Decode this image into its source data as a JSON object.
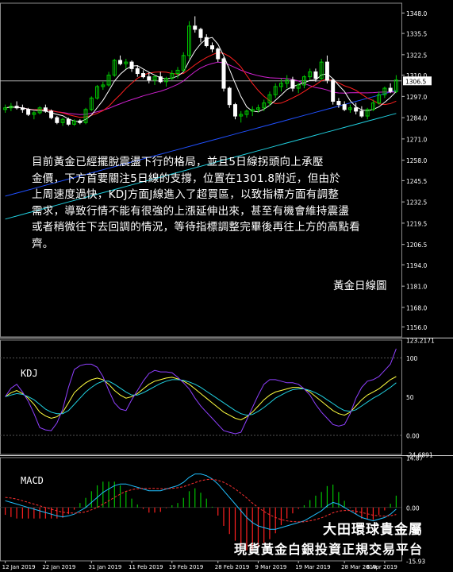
{
  "commentary": {
    "lines": [
      "目前黃金已經擺脫震盪下行的格局，並且5日線拐頭向上承壓",
      "金價，下方首要關注5日線的支撐，位置在1301.8附近，但由於",
      "上周速度過快，KDJ方面J線進入了超買區，以致指標方面有調整",
      "需求，導致行情不能有很強的上漲延伸出來，甚至有機會維持震盪",
      "或者稍微往下去回調的情況，等待指標調整完畢後再往上方的高點看",
      "齊。"
    ]
  },
  "chart_title": "黃金日線圖",
  "brand": {
    "line1": "大田環球貴金屬",
    "line2": "現貨黃金白銀投資正規交易平台"
  },
  "colors": {
    "bull_candle": "#00c800",
    "bear_candle": "#ffffff",
    "ma5": "#ffffff",
    "ma10": "#ff2020",
    "ma20": "#d020d0",
    "ma60": "#2050ff",
    "ma120": "#20d0e0",
    "k_line": "#ffff40",
    "d_line": "#20d0e0",
    "j_line": "#9040ff",
    "macd_line": "#20c0ff",
    "signal_line": "#ff3030",
    "hist_pos": "#00c000",
    "hist_neg": "#ff2020",
    "current_price_line": "#c0c0c0",
    "price_tag_bg": "#ffffff"
  },
  "chart_data": [
    {
      "type": "candlestick",
      "panel": "price",
      "current_price": 1306.5,
      "ylim": [
        1150,
        1354
      ],
      "y_ticks": [
        1348.0,
        1335.5,
        1322.5,
        1310.0,
        1297.0,
        1284.0,
        1271.0,
        1258.0,
        1245.5,
        1232.5,
        1219.5,
        1206.5,
        1194.0,
        1181.0,
        1168.0,
        1156.0
      ],
      "x_tick_labels": [
        "12 Jan 2019",
        "22 Jan 2019",
        "31 Jan 2019",
        "11 Feb 2019",
        "19 Feb 2019",
        "28 Feb 2019",
        "9 Mar 2019",
        "19 Mar 2019",
        "28 Mar 2019",
        "6 Apr 2019"
      ],
      "ohlc": [
        [
          1289,
          1292,
          1287,
          1290
        ],
        [
          1290,
          1293,
          1288,
          1291
        ],
        [
          1291,
          1294,
          1289,
          1290
        ],
        [
          1290,
          1292,
          1287,
          1289
        ],
        [
          1289,
          1290,
          1285,
          1286
        ],
        [
          1286,
          1288,
          1283,
          1287
        ],
        [
          1287,
          1291,
          1286,
          1290
        ],
        [
          1290,
          1292,
          1287,
          1288
        ],
        [
          1288,
          1289,
          1283,
          1284
        ],
        [
          1284,
          1285,
          1280,
          1281
        ],
        [
          1281,
          1284,
          1279,
          1283
        ],
        [
          1283,
          1284,
          1279,
          1280
        ],
        [
          1280,
          1283,
          1279,
          1282
        ],
        [
          1282,
          1283,
          1280,
          1281
        ],
        [
          1281,
          1290,
          1280,
          1289
        ],
        [
          1289,
          1297,
          1288,
          1296
        ],
        [
          1296,
          1304,
          1295,
          1303
        ],
        [
          1303,
          1306,
          1301,
          1304
        ],
        [
          1304,
          1312,
          1303,
          1310
        ],
        [
          1310,
          1320,
          1309,
          1319
        ],
        [
          1319,
          1322,
          1316,
          1317
        ],
        [
          1317,
          1320,
          1314,
          1318
        ],
        [
          1318,
          1319,
          1312,
          1314
        ],
        [
          1314,
          1316,
          1309,
          1311
        ],
        [
          1311,
          1313,
          1308,
          1309
        ],
        [
          1309,
          1312,
          1305,
          1307
        ],
        [
          1307,
          1310,
          1304,
          1309
        ],
        [
          1309,
          1312,
          1305,
          1306
        ],
        [
          1306,
          1309,
          1303,
          1308
        ],
        [
          1308,
          1313,
          1307,
          1311
        ],
        [
          1311,
          1315,
          1308,
          1313
        ],
        [
          1313,
          1324,
          1312,
          1322
        ],
        [
          1322,
          1343,
          1320,
          1340
        ],
        [
          1340,
          1346,
          1336,
          1338
        ],
        [
          1338,
          1339,
          1330,
          1333
        ],
        [
          1333,
          1335,
          1327,
          1328
        ],
        [
          1328,
          1330,
          1324,
          1326
        ],
        [
          1326,
          1327,
          1318,
          1320
        ],
        [
          1320,
          1321,
          1300,
          1302
        ],
        [
          1302,
          1303,
          1290,
          1292
        ],
        [
          1292,
          1293,
          1283,
          1285
        ],
        [
          1285,
          1288,
          1281,
          1286
        ],
        [
          1286,
          1289,
          1284,
          1288
        ],
        [
          1288,
          1291,
          1285,
          1289
        ],
        [
          1289,
          1292,
          1287,
          1290
        ],
        [
          1290,
          1295,
          1288,
          1293
        ],
        [
          1293,
          1300,
          1291,
          1298
        ],
        [
          1298,
          1305,
          1296,
          1303
        ],
        [
          1303,
          1308,
          1300,
          1305
        ],
        [
          1305,
          1310,
          1302,
          1307
        ],
        [
          1307,
          1309,
          1300,
          1302
        ],
        [
          1302,
          1305,
          1299,
          1304
        ],
        [
          1304,
          1310,
          1302,
          1309
        ],
        [
          1309,
          1314,
          1307,
          1312
        ],
        [
          1312,
          1314,
          1306,
          1308
        ],
        [
          1308,
          1320,
          1307,
          1318
        ],
        [
          1318,
          1322,
          1305,
          1307
        ],
        [
          1307,
          1308,
          1292,
          1294
        ],
        [
          1294,
          1296,
          1290,
          1292
        ],
        [
          1292,
          1294,
          1288,
          1289
        ],
        [
          1289,
          1292,
          1287,
          1290
        ],
        [
          1290,
          1293,
          1286,
          1288
        ],
        [
          1288,
          1291,
          1284,
          1285
        ],
        [
          1285,
          1290,
          1283,
          1289
        ],
        [
          1289,
          1295,
          1288,
          1293
        ],
        [
          1293,
          1300,
          1292,
          1298
        ],
        [
          1298,
          1303,
          1296,
          1302
        ],
        [
          1302,
          1305,
          1299,
          1300
        ],
        [
          1300,
          1310,
          1299,
          1307
        ]
      ]
    },
    {
      "type": "line",
      "panel": "kdj",
      "title": "KDJ",
      "ylim": [
        -24.6891,
        123.2171
      ],
      "y_ticks": [
        123.2171,
        100,
        50,
        0.0,
        -24.6891
      ],
      "series": [
        {
          "name": "K",
          "values": [
            50,
            55,
            58,
            54,
            48,
            40,
            30,
            25,
            22,
            24,
            30,
            42,
            55,
            62,
            68,
            72,
            74,
            72,
            66,
            58,
            52,
            48,
            50,
            54,
            60,
            66,
            70,
            72,
            74,
            75,
            73,
            70,
            66,
            60,
            54,
            48,
            42,
            36,
            30,
            26,
            22,
            20,
            24,
            30,
            38,
            46,
            52,
            56,
            58,
            60,
            62,
            62,
            60,
            56,
            50,
            44,
            38,
            32,
            28,
            26,
            30,
            38,
            46,
            52,
            56,
            60,
            66,
            72,
            76
          ]
        },
        {
          "name": "D",
          "values": [
            50,
            52,
            54,
            53,
            50,
            46,
            40,
            34,
            30,
            28,
            28,
            32,
            40,
            48,
            56,
            62,
            67,
            70,
            70,
            66,
            61,
            56,
            52,
            52,
            55,
            59,
            63,
            67,
            70,
            72,
            72,
            71,
            69,
            66,
            62,
            57,
            52,
            47,
            42,
            37,
            32,
            28,
            26,
            27,
            31,
            36,
            42,
            48,
            52,
            56,
            59,
            60,
            60,
            58,
            55,
            51,
            46,
            41,
            36,
            32,
            31,
            33,
            38,
            43,
            48,
            52,
            57,
            62,
            68
          ]
        },
        {
          "name": "J",
          "values": [
            50,
            61,
            66,
            56,
            44,
            28,
            10,
            7,
            6,
            16,
            34,
            62,
            85,
            90,
            92,
            92,
            88,
            76,
            58,
            42,
            34,
            32,
            46,
            58,
            70,
            80,
            84,
            82,
            82,
            81,
            75,
            68,
            60,
            48,
            38,
            30,
            22,
            14,
            6,
            4,
            2,
            4,
            20,
            36,
            52,
            66,
            72,
            72,
            70,
            68,
            68,
            66,
            60,
            52,
            40,
            30,
            22,
            14,
            12,
            14,
            28,
            48,
            62,
            70,
            72,
            76,
            84,
            92,
            112
          ]
        }
      ]
    },
    {
      "type": "bar+line",
      "panel": "macd",
      "title": "MACD",
      "ylim": [
        -15.93,
        14.87
      ],
      "y_ticks": [
        14.87,
        0.0,
        -15.93
      ],
      "series": [
        {
          "name": "MACD",
          "values": [
            2,
            1.5,
            1,
            0.5,
            0,
            -0.5,
            -1,
            -1.5,
            -2,
            -2.5,
            -2.8,
            -2.5,
            -2,
            -1,
            0,
            1.5,
            3,
            4.5,
            5.5,
            6.5,
            7,
            7,
            6.5,
            6,
            5.5,
            5,
            5,
            5,
            5.5,
            6,
            6.5,
            7.5,
            9,
            10,
            10,
            9.5,
            8.5,
            7,
            5,
            3,
            1,
            -1,
            -3,
            -4.5,
            -5.5,
            -6,
            -6.5,
            -6.5,
            -6,
            -5.5,
            -5,
            -4.5,
            -4,
            -3,
            -2,
            -1,
            0.5,
            1.5,
            1,
            0,
            -1,
            -2,
            -3,
            -3.5,
            -4,
            -3.5,
            -3,
            -2,
            -0.5
          ]
        },
        {
          "name": "Signal",
          "values": [
            3,
            2.8,
            2.5,
            2,
            1.5,
            1,
            0.5,
            0,
            -0.5,
            -1,
            -1.4,
            -1.6,
            -1.7,
            -1.6,
            -1.3,
            -0.7,
            0,
            1,
            2,
            3,
            4,
            4.8,
            5.3,
            5.6,
            5.7,
            5.7,
            5.7,
            5.6,
            5.6,
            5.7,
            5.9,
            6.2,
            6.8,
            7.4,
            8,
            8.3,
            8.4,
            8.1,
            7.5,
            6.6,
            5.5,
            4.2,
            2.8,
            1.3,
            0,
            -1.2,
            -2.2,
            -3,
            -3.6,
            -4,
            -4.2,
            -4.3,
            -4.3,
            -4,
            -3.6,
            -3.1,
            -2.4,
            -1.6,
            -1.1,
            -0.9,
            -0.9,
            -1.1,
            -1.5,
            -1.9,
            -2.3,
            -2.5,
            -2.6,
            -2.5,
            -2.1
          ]
        }
      ]
    }
  ]
}
